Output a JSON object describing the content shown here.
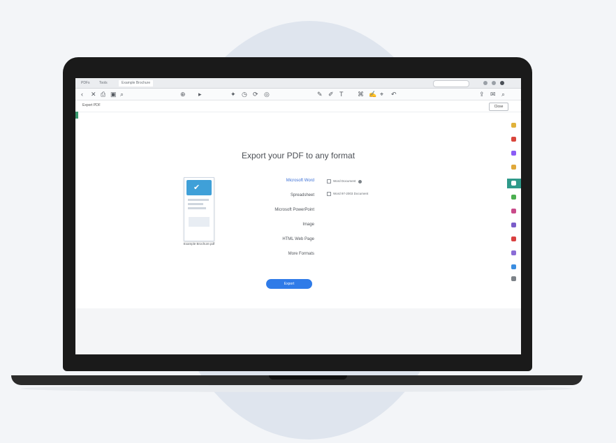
{
  "window": {
    "tabs": [
      {
        "label": "PDFs"
      },
      {
        "label": "Tools"
      },
      {
        "label": "Example Brochure"
      }
    ]
  },
  "toolbar": {
    "icons": [
      "back-icon",
      "close-icon",
      "print-icon",
      "save-icon",
      "search-icon",
      "zoom-icon",
      "select-icon",
      "comment-icon",
      "shape-icon",
      "rotate-icon",
      "highlight-icon",
      "sign-icon",
      "draw-icon",
      "undo-icon"
    ],
    "close_label": "Close"
  },
  "breadcrumb": "Export PDF",
  "main": {
    "headline": "Export your PDF to any format",
    "document_caption": "Example Brochure.pdf",
    "formats": [
      {
        "label": "Microsoft Word",
        "selected": true
      },
      {
        "label": "Spreadsheet",
        "selected": false
      },
      {
        "label": "Microsoft PowerPoint",
        "selected": false
      },
      {
        "label": "Image",
        "selected": false
      },
      {
        "label": "HTML Web Page",
        "selected": false
      },
      {
        "label": "More Formats",
        "selected": false
      }
    ],
    "options": [
      {
        "label": "Word Document"
      },
      {
        "label": "Word 97-2003 Document"
      }
    ],
    "export_label": "Export"
  },
  "right_rail": {
    "icons": [
      {
        "name": "export-pdf-icon",
        "color": "#e0b23a"
      },
      {
        "name": "create-pdf-icon",
        "color": "#d9463c"
      },
      {
        "name": "edit-pdf-icon",
        "color": "#8b5cf6"
      },
      {
        "name": "comment-icon",
        "color": "#e0a83a"
      },
      {
        "name": "combine-icon",
        "color": "#2f9a8a",
        "active": true
      },
      {
        "name": "organize-icon",
        "color": "#4caf50"
      },
      {
        "name": "redact-icon",
        "color": "#c94b8a"
      },
      {
        "name": "protect-icon",
        "color": "#7a5cc9"
      },
      {
        "name": "optimize-icon",
        "color": "#d94040"
      },
      {
        "name": "fill-sign-icon",
        "color": "#8a6cd6"
      },
      {
        "name": "send-icon",
        "color": "#3b8de0"
      },
      {
        "name": "more-tools-icon",
        "color": "#7c8288"
      }
    ]
  },
  "colors": {
    "accent": "#2f7be8",
    "selected_format": "#3b6fd6",
    "laptop_frame": "#1a1a1a"
  }
}
